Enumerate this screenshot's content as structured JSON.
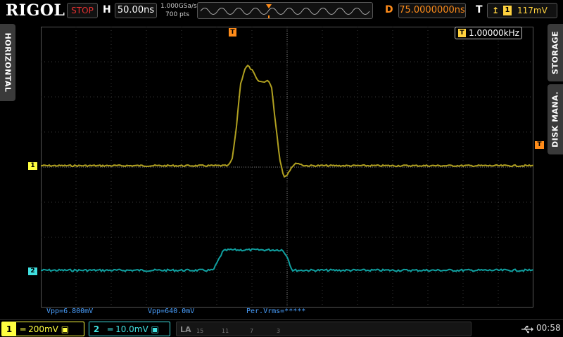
{
  "header": {
    "brand": "RIGOL",
    "run_state": "STOP",
    "horizontal_letter": "H",
    "timebase": "50.00ns",
    "sample_rate": "1.000GSa/s",
    "memory_depth": "700 pts",
    "delay_letter": "D",
    "delay": "75.0000000ns",
    "trigger_letter": "T",
    "trigger_source": "1",
    "trigger_level": "117mV"
  },
  "side_tabs": {
    "left": "HORIZONTAL",
    "right_top": "STORAGE",
    "right_bottom": "DISK MANA."
  },
  "screen": {
    "frequency_counter": "1.00000kHz",
    "counter_icon": "T",
    "ch1_marker": "1",
    "ch2_marker": "2",
    "trigger_level_marker": "T",
    "trigger_position_marker": "T"
  },
  "waveforms": {
    "ch1": {
      "color": "#b0a020",
      "points": [
        [
          0,
          0
        ],
        [
          38,
          0
        ],
        [
          38.8,
          0.15
        ],
        [
          39.6,
          0.95
        ],
        [
          40.5,
          2.3
        ],
        [
          41.4,
          2.75
        ],
        [
          42,
          2.85
        ],
        [
          43,
          2.7
        ],
        [
          44,
          2.42
        ],
        [
          45,
          2.38
        ],
        [
          46,
          2.42
        ],
        [
          46.8,
          2.3
        ],
        [
          47.5,
          1.4
        ],
        [
          48.5,
          0.2
        ],
        [
          49.3,
          -0.32
        ],
        [
          50,
          -0.25
        ],
        [
          51,
          -0.02
        ],
        [
          52,
          0.08
        ],
        [
          53.5,
          0
        ],
        [
          100,
          0
        ]
      ]
    },
    "ch2": {
      "color": "#10a0a0",
      "points": [
        [
          0,
          0
        ],
        [
          35,
          0
        ],
        [
          37,
          0.55
        ],
        [
          38,
          0.58
        ],
        [
          49,
          0.58
        ],
        [
          50,
          0.4
        ],
        [
          51,
          0
        ],
        [
          100,
          0
        ]
      ]
    }
  },
  "measurements": {
    "vpp1": "Vpp=6.800mV",
    "vpp2": "Vpp=640.0mV",
    "vrms": "Per.Vrms=*****"
  },
  "bottom": {
    "ch1_number": "1",
    "ch1_scale": "200mV",
    "ch2_number": "2",
    "ch2_scale": "10.0mV",
    "la_label": "LA",
    "la_channels": [
      "15",
      "11",
      "7",
      "3"
    ],
    "clock": "00:58"
  },
  "colors": {
    "ch1": "#ffff40",
    "ch2": "#40e0e0",
    "trigger": "#ff8c1a",
    "stop": "#e03030",
    "measure": "#4aa0ff"
  }
}
